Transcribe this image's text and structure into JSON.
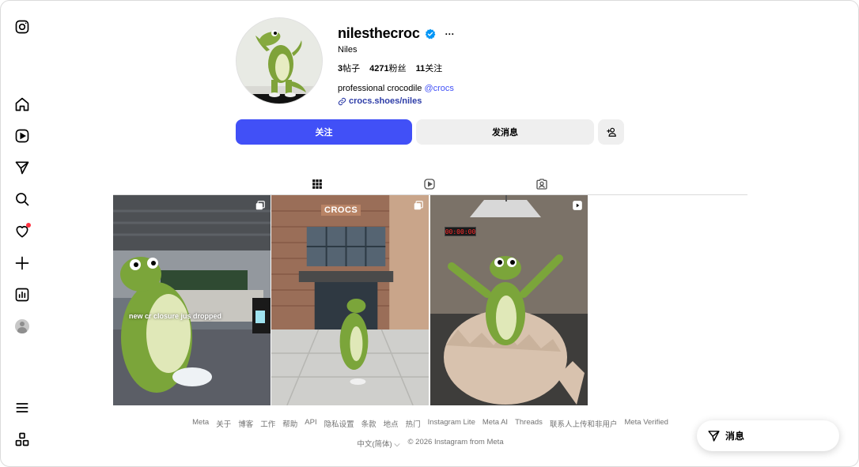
{
  "nav": {
    "items": [
      {
        "name": "instagram-logo-icon"
      },
      {
        "name": "home-icon"
      },
      {
        "name": "reels-icon"
      },
      {
        "name": "direct-send-icon"
      },
      {
        "name": "search-icon"
      },
      {
        "name": "heart-icon"
      },
      {
        "name": "plus-create-icon"
      },
      {
        "name": "dashboard-icon"
      },
      {
        "name": "profile-avatar"
      },
      {
        "name": "menu-icon"
      },
      {
        "name": "apps-grid-icon"
      }
    ]
  },
  "profile": {
    "username": "nilesthecroc",
    "more": "···",
    "full_name": "Niles",
    "posts_count": "3",
    "posts_label": "帖子",
    "followers_count": "4271",
    "followers_label": "粉丝",
    "following_count": "11",
    "following_label": "关注",
    "bio_text": "professional crocodile ",
    "bio_mention": "@crocs",
    "link": "crocs.shoes/niles"
  },
  "actions": {
    "follow": "关注",
    "message": "发消息",
    "add_user": "+"
  },
  "tabs": [
    {
      "name": "posts-grid-icon",
      "active": true
    },
    {
      "name": "reels-icon",
      "active": false
    },
    {
      "name": "tagged-icon",
      "active": false
    }
  ],
  "posts": [
    {
      "caption": "new cr  closure jus dropped",
      "badge": "carousel-icon"
    },
    {
      "sign": "CROCS",
      "badge": "carousel-icon"
    },
    {
      "timer": "00:00:00",
      "badge": "reel-play-icon"
    }
  ],
  "footer": {
    "links": [
      "Meta",
      "关于",
      "博客",
      "工作",
      "帮助",
      "API",
      "隐私设置",
      "条款",
      "地点",
      "热门",
      "Instagram Lite",
      "Meta AI",
      "Threads",
      "联系人上传和非用户",
      "Meta Verified"
    ],
    "language": "中文(简体)",
    "copyright": "© 2026 Instagram from Meta"
  },
  "messages_pill": {
    "label": "消息"
  },
  "colors": {
    "accent": "#4150f7",
    "link": "#2e3da8",
    "notification": "#ff3040",
    "muted": "#737373"
  }
}
